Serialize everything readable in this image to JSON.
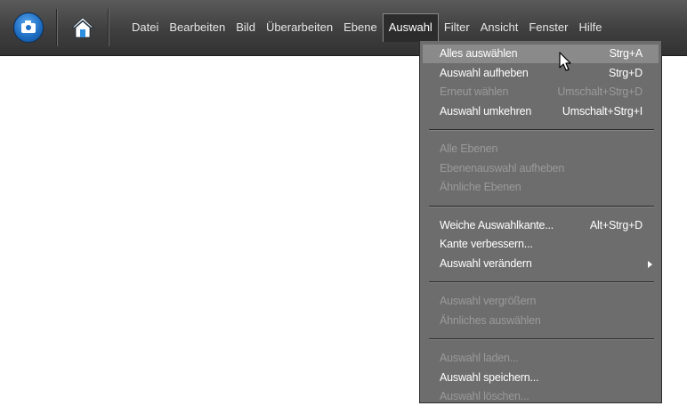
{
  "app": {
    "icon": "camera-icon",
    "home_icon": "home-icon"
  },
  "menubar": {
    "items": [
      "Datei",
      "Bearbeiten",
      "Bild",
      "Überarbeiten",
      "Ebene",
      "Auswahl",
      "Filter",
      "Ansicht",
      "Fenster",
      "Hilfe"
    ],
    "active": "Auswahl"
  },
  "dropdown": {
    "groups": [
      [
        {
          "label": "Alles auswählen",
          "shortcut": "Strg+A",
          "enabled": true,
          "highlighted": true
        },
        {
          "label": "Auswahl aufheben",
          "shortcut": "Strg+D",
          "enabled": true
        },
        {
          "label": "Erneut wählen",
          "shortcut": "Umschalt+Strg+D",
          "enabled": false
        },
        {
          "label": "Auswahl umkehren",
          "shortcut": "Umschalt+Strg+I",
          "enabled": true
        }
      ],
      [
        {
          "label": "Alle Ebenen",
          "shortcut": "",
          "enabled": false
        },
        {
          "label": "Ebenenauswahl aufheben",
          "shortcut": "",
          "enabled": false
        },
        {
          "label": "Ähnliche Ebenen",
          "shortcut": "",
          "enabled": false
        }
      ],
      [
        {
          "label": "Weiche Auswahlkante...",
          "shortcut": "Alt+Strg+D",
          "enabled": true
        },
        {
          "label": "Kante verbessern...",
          "shortcut": "",
          "enabled": true
        },
        {
          "label": "Auswahl verändern",
          "shortcut": "",
          "enabled": true,
          "submenu": true
        }
      ],
      [
        {
          "label": "Auswahl vergrößern",
          "shortcut": "",
          "enabled": false
        },
        {
          "label": "Ähnliches auswählen",
          "shortcut": "",
          "enabled": false
        }
      ],
      [
        {
          "label": "Auswahl laden...",
          "shortcut": "",
          "enabled": false
        },
        {
          "label": "Auswahl speichern...",
          "shortcut": "",
          "enabled": true
        },
        {
          "label": "Auswahl löschen...",
          "shortcut": "",
          "enabled": false
        }
      ]
    ]
  },
  "colors": {
    "menubar": "#3f3f3f",
    "menu_bg": "#6d6d6d",
    "highlight": "#8a8a8a",
    "disabled_text": "#9a9a9a"
  }
}
